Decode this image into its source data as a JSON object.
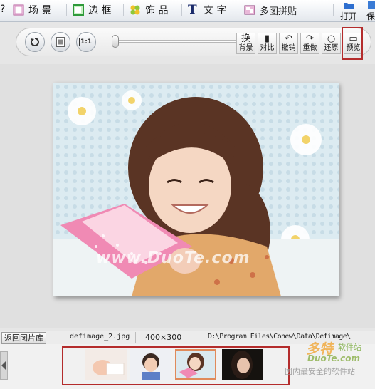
{
  "topbar": {
    "tabs": [
      {
        "label": "场 景",
        "icon": "scene-icon"
      },
      {
        "label": "边 框",
        "icon": "frame-icon"
      },
      {
        "label": "饰 品",
        "icon": "clover-icon"
      },
      {
        "label": "文 字",
        "icon": "text-T-icon"
      },
      {
        "label": "多图拼贴",
        "icon": "collage-icon"
      }
    ],
    "open_label": "打开",
    "save_label_partial": "保"
  },
  "toolbar": {
    "rotate_icon": "rotate-icon",
    "fit_icon": "fit-screen-icon",
    "actual_size_label": "1:1",
    "zoom_level": 0,
    "tools": [
      {
        "label": "背景",
        "symbol": "换"
      },
      {
        "label": "对比",
        "symbol": "▮"
      },
      {
        "label": "撤销",
        "symbol": "↶"
      },
      {
        "label": "重做",
        "symbol": "↷"
      },
      {
        "label": "还原",
        "symbol": "○"
      },
      {
        "label": "预览",
        "symbol": "▭"
      }
    ]
  },
  "canvas": {
    "watermark": "www.DuoTe.com"
  },
  "status": {
    "back_label": "返回图片库",
    "filename": "defimage_2.jpg",
    "dimensions": "400×300",
    "path": "D:\\Program Files\\Conew\\Data\\Defimage\\"
  },
  "thumbnails": {
    "selected_index": 2,
    "count": 4
  },
  "site_logo": {
    "brand": "多特",
    "brand_sub": "软件站",
    "domain": "DuoTe.com",
    "slogan": "国内最安全的软件站"
  },
  "colors": {
    "highlight": "#b42c2c",
    "thumb_selected": "#e08a5a"
  }
}
